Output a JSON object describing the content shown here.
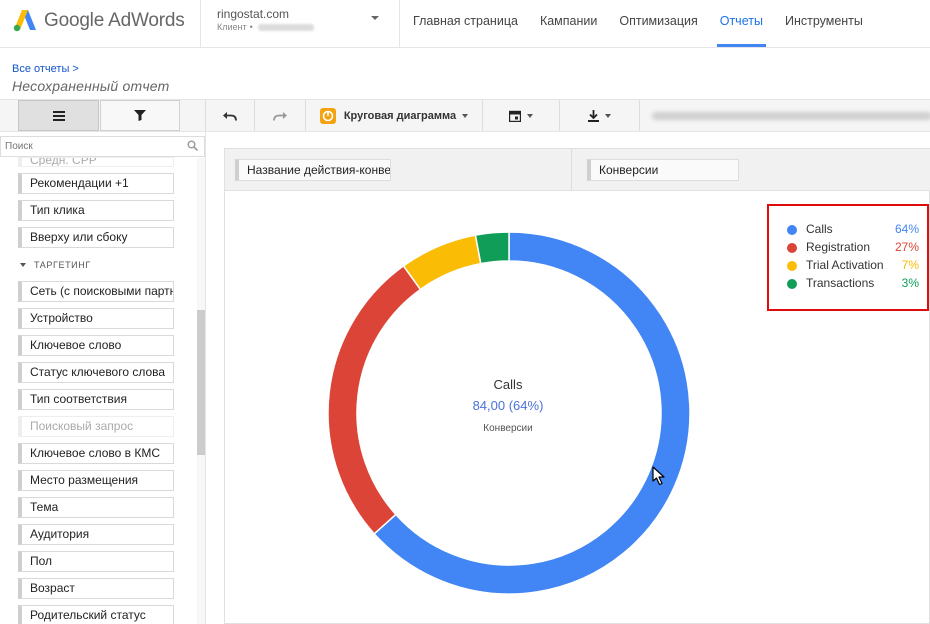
{
  "header": {
    "logo_text": "Google AdWords",
    "account_name": "ringostat.com",
    "account_sub": "Клиент",
    "nav": [
      {
        "label": "Главная страница",
        "active": false
      },
      {
        "label": "Кампании",
        "active": false
      },
      {
        "label": "Оптимизация",
        "active": false
      },
      {
        "label": "Отчеты",
        "active": true
      },
      {
        "label": "Инструменты",
        "active": false
      }
    ]
  },
  "breadcrumb": {
    "link": "Все отчеты >",
    "title": "Несохраненный отчет"
  },
  "toolbar": {
    "chart_type_label": "Круговая диаграмма",
    "icons": [
      "list-icon",
      "filter-icon",
      "undo-icon",
      "redo-icon",
      "pie-chart-icon",
      "calendar-icon",
      "download-icon"
    ]
  },
  "sidebar": {
    "search_placeholder": "Поиск",
    "items": [
      {
        "label": "Средн. CPP",
        "faded": true,
        "clipped": true
      },
      {
        "label": "Рекомендации +1"
      },
      {
        "label": "Тип клика"
      },
      {
        "label": "Вверху или сбоку"
      },
      {
        "section": "ТАРГЕТИНГ"
      },
      {
        "label": "Сеть (с поисковыми партнерами)"
      },
      {
        "label": "Устройство"
      },
      {
        "label": "Ключевое слово"
      },
      {
        "label": "Статус ключевого слова"
      },
      {
        "label": "Тип соответствия"
      },
      {
        "label": "Поисковый запрос",
        "faded": true
      },
      {
        "label": "Ключевое слово в КМС"
      },
      {
        "label": "Место размещения"
      },
      {
        "label": "Тема"
      },
      {
        "label": "Аудитория"
      },
      {
        "label": "Пол"
      },
      {
        "label": "Возраст"
      },
      {
        "label": "Родительский статус"
      }
    ]
  },
  "chips": {
    "dimension": "Название действия-конвертации",
    "metric": "Конверсии"
  },
  "chart_data": {
    "type": "pie",
    "donut": true,
    "categories": [
      "Calls",
      "Registration",
      "Trial Activation",
      "Transactions"
    ],
    "values": [
      64,
      27,
      7,
      3
    ],
    "percent_labels": [
      "64%",
      "27%",
      "7%",
      "3%"
    ],
    "colors": [
      "#4285f4",
      "#db4437",
      "#fbbc05",
      "#0f9d58"
    ],
    "legend_position": "top-right",
    "center_label": {
      "name": "Calls",
      "value": "84,00 (64%)",
      "metric": "Конверсии"
    }
  }
}
